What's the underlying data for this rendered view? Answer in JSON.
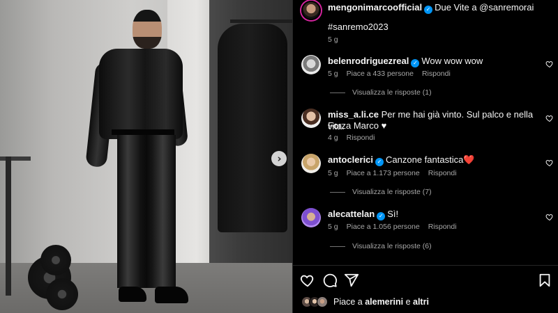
{
  "post": {
    "author": "mengonimarcoofficial",
    "caption_text": "Due Vite a @sanremorai",
    "hashtag": "#sanremo2023",
    "time": "5 g"
  },
  "comments": [
    {
      "username": "belenrodriguezreal",
      "verified": true,
      "text": "Wow wow wow",
      "time": "5 g",
      "likes": "Piace a 433 persone",
      "reply": "Rispondi",
      "view_replies": "Visualizza le risposte (1)"
    },
    {
      "username": "miss_a.li.ce",
      "verified": false,
      "text": "Per me hai già vinto. Sul palco e nella vita.",
      "text_line2": "Forza Marco ♥",
      "time": "4 g",
      "reply": "Rispondi"
    },
    {
      "username": "antoclerici",
      "verified": true,
      "text": "Canzone fantastica❤️",
      "time": "5 g",
      "likes": "Piace a 1.173 persone",
      "reply": "Rispondi",
      "view_replies": "Visualizza le risposte (7)"
    },
    {
      "username": "alecattelan",
      "verified": true,
      "text": "Sì!",
      "time": "5 g",
      "likes": "Piace a 1.056 persone",
      "reply": "Rispondi",
      "view_replies": "Visualizza le risposte (6)"
    }
  ],
  "actions": {
    "icons": [
      "heart-icon",
      "comment-icon",
      "share-icon",
      "bookmark-icon"
    ]
  },
  "likes_summary": {
    "prefix": "Piace a",
    "first_user": "alemerini",
    "conjunction": "e",
    "others": "altri"
  },
  "colors": {
    "background": "#000000",
    "text": "#f5f5f5",
    "secondary_text": "#a8a8a8",
    "verified_badge": "#0095f6",
    "divider": "#262626"
  }
}
